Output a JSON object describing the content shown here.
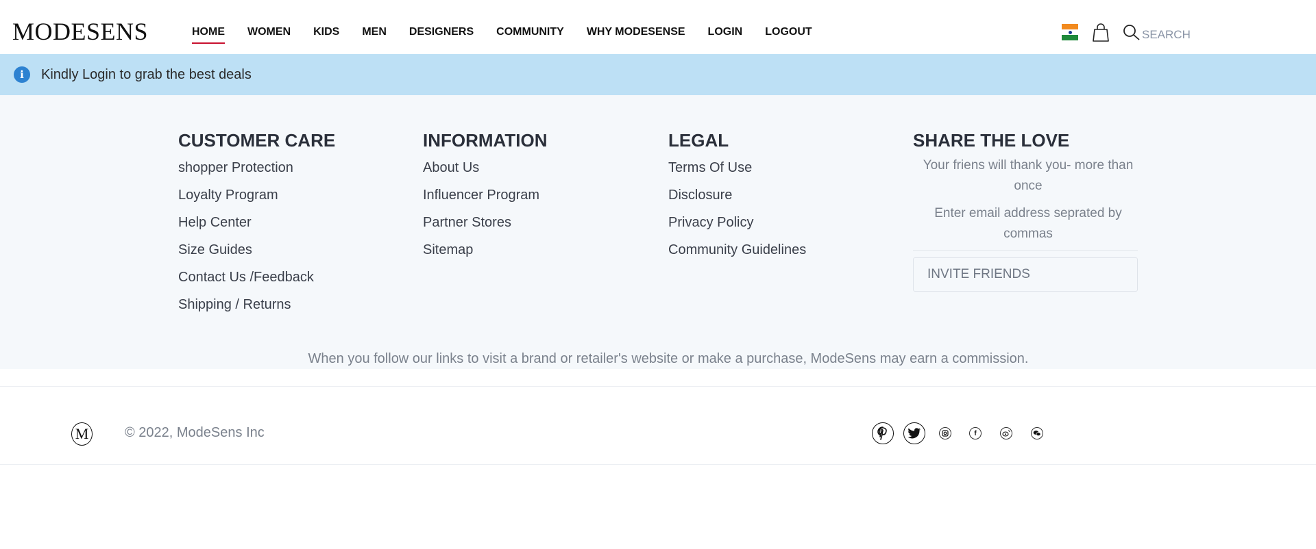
{
  "header": {
    "logo": "MODESENS",
    "nav": [
      "HOME",
      "WOMEN",
      "KIDS",
      "MEN",
      "DESIGNERS",
      "COMMUNITY",
      "WHY MODESENSE",
      "LOGIN",
      "LOGOUT"
    ],
    "active_nav": "HOME",
    "search_label": "SEARCH",
    "icons": [
      "india-flag-icon",
      "shopping-bag-icon",
      "search-icon"
    ]
  },
  "alert": {
    "icon": "info-icon",
    "text": "Kindly Login to grab the best deals"
  },
  "footer": {
    "customer_care": {
      "title": "CUSTOMER CARE",
      "links": [
        "shopper Protection",
        "Loyalty Program",
        "Help Center",
        "Size Guides",
        "Contact Us /Feedback",
        "Shipping / Returns"
      ]
    },
    "information": {
      "title": "INFORMATION",
      "links": [
        "About Us",
        "Influencer Program",
        "Partner Stores",
        "Sitemap"
      ]
    },
    "legal": {
      "title": "LEGAL",
      "links": [
        "Terms Of Use",
        "Disclosure",
        "Privacy Policy",
        "Community Guidelines"
      ]
    },
    "share": {
      "title": "SHARE THE LOVE",
      "description": "Your friens will thank you- more than once",
      "email_prompt": "Enter email address seprated by commas",
      "invite_button": "INVITE FRIENDS"
    },
    "disclaimer": "When you follow our links to visit a brand or retailer's website or make a purchase, ModeSens may earn a commission."
  },
  "bottom": {
    "mini_logo": "M",
    "copyright": "© 2022, ModeSens Inc",
    "social_icons": [
      "pinterest-icon",
      "twitter-icon",
      "instagram-icon",
      "facebook-icon",
      "weibo-icon",
      "wechat-icon"
    ]
  },
  "colors": {
    "alert_bg": "#bde0f5",
    "alert_icon": "#2d82d1",
    "active_underline": "#c8102e",
    "footer_bg": "#f5f8fb"
  }
}
